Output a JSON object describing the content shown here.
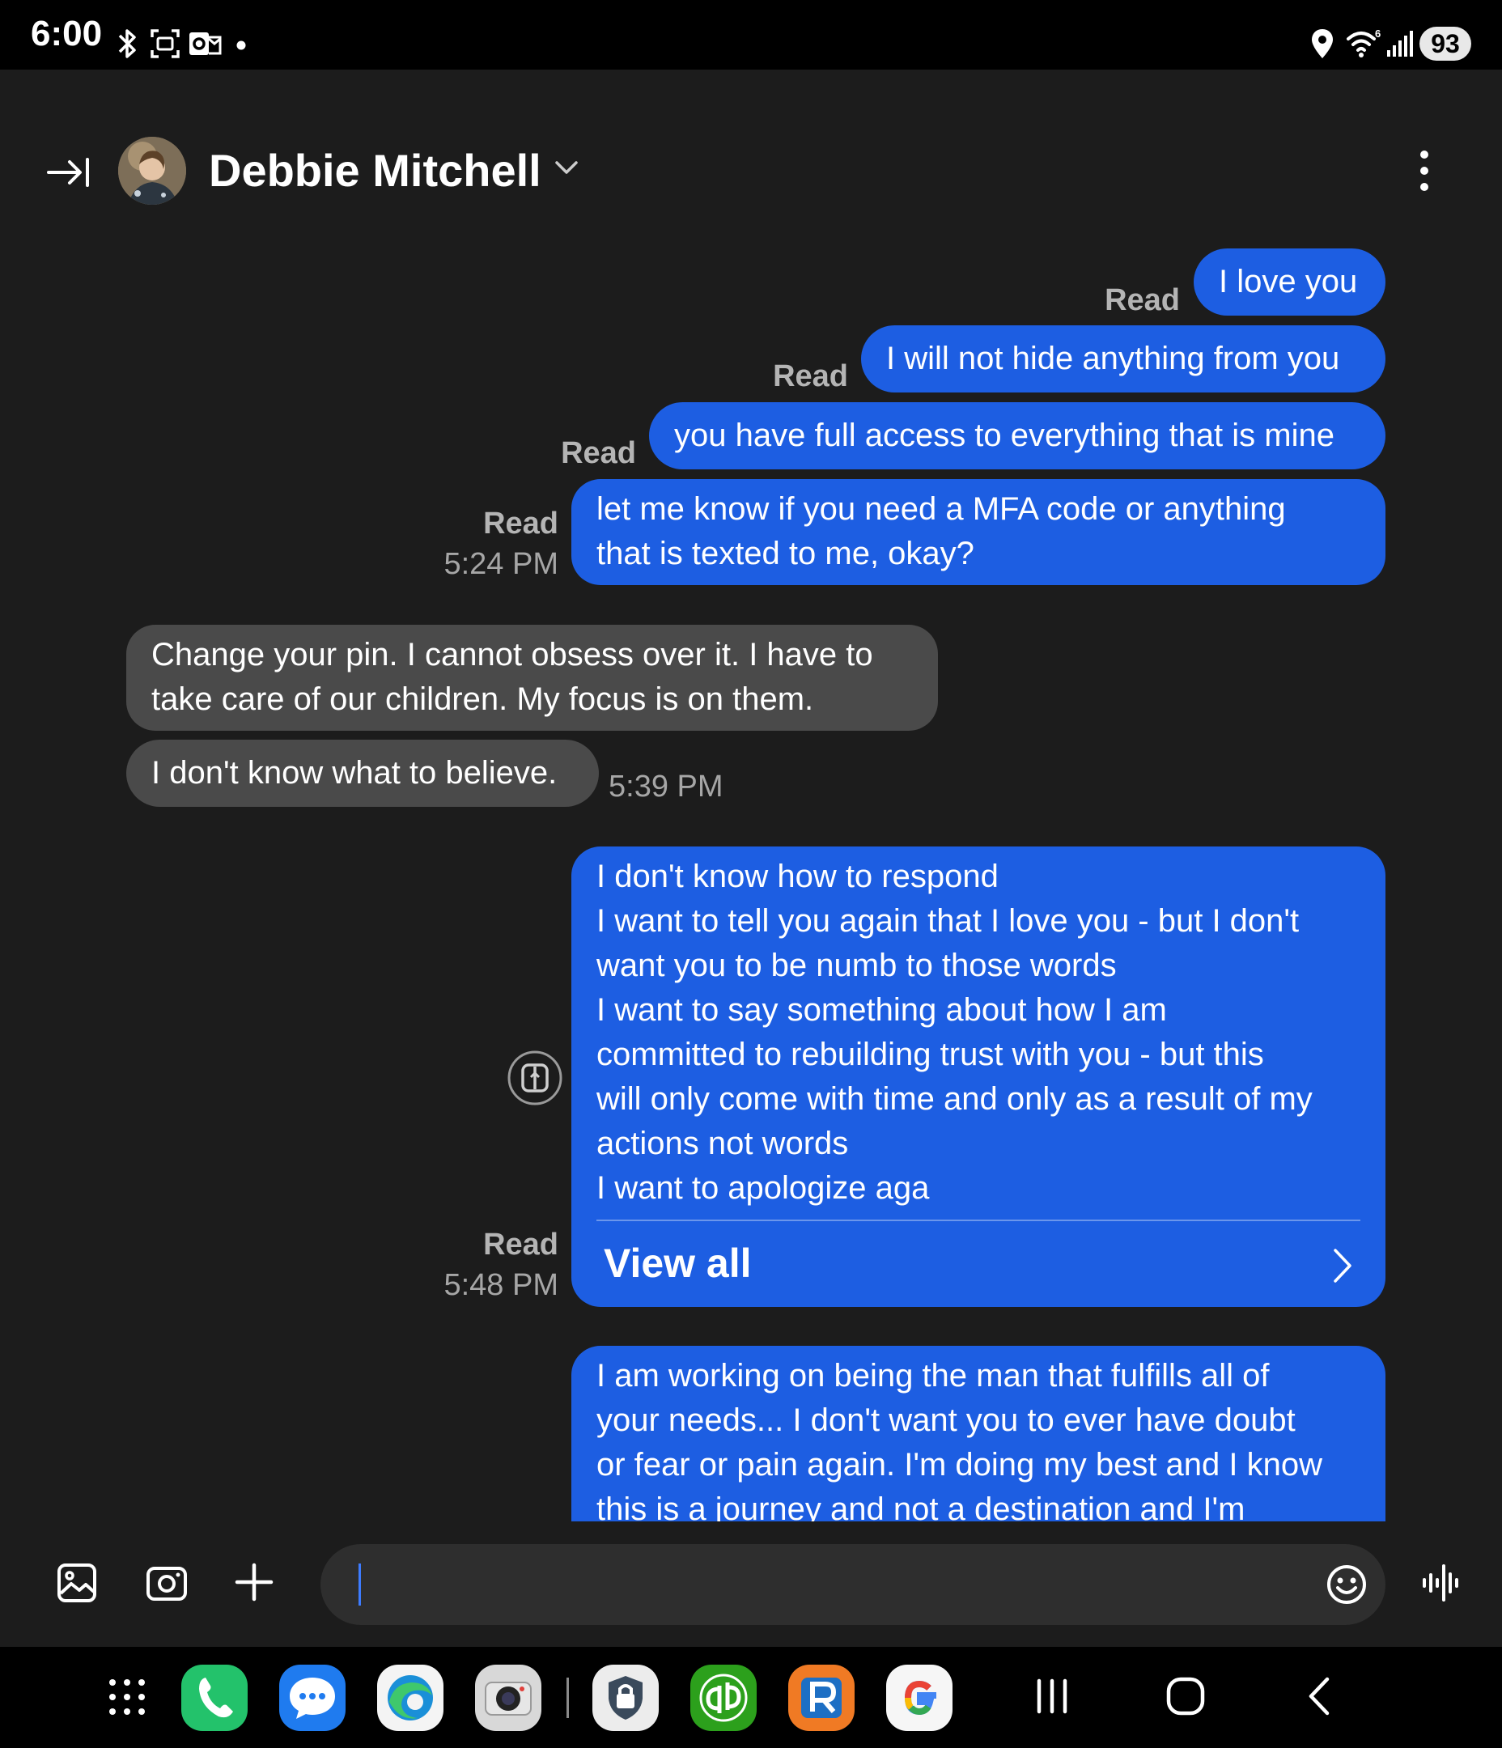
{
  "status_bar": {
    "time": "6:00",
    "battery": "93",
    "left_icons": [
      "bluetooth-icon",
      "screenshot-icon",
      "outlook-icon",
      "notification-dot-icon"
    ],
    "right_icons": [
      "location-icon",
      "wifi-6-icon",
      "signal-icon"
    ]
  },
  "header": {
    "contact_name": "Debbie Mitchell",
    "icons": [
      "collapse-panel-icon",
      "contact-avatar",
      "chevron-down-icon",
      "more-options-icon"
    ]
  },
  "messages": [
    {
      "direction": "sent",
      "text": "I love you",
      "status": "Read",
      "time": ""
    },
    {
      "direction": "sent",
      "text": "I will not hide anything from you",
      "status": "Read",
      "time": ""
    },
    {
      "direction": "sent",
      "text": "you have full access to everything that is mine",
      "status": "Read",
      "time": ""
    },
    {
      "direction": "sent",
      "text": "let me know if you need a MFA code or anything\nthat is texted to me, okay?",
      "status": "Read",
      "time": "5:24 PM"
    },
    {
      "direction": "received",
      "text": "Change your pin. I cannot obsess over it.  I have to\ntake care of our children.  My focus is on them.",
      "status": "",
      "time": ""
    },
    {
      "direction": "received",
      "text": "I don't know what to believe.",
      "status": "",
      "time": "5:39 PM"
    },
    {
      "direction": "sent",
      "text": "I don't know how to respond\nI want to tell you again that I love you - but I don't\nwant you to be numb to those words\nI want to say something about how I am\ncommitted to rebuilding trust with you - but this\nwill only come with time and only as a result of my\nactions not words\nI want to apologize aga",
      "status": "Read",
      "time": "5:48 PM",
      "view_all_label": "View all"
    },
    {
      "direction": "sent",
      "text": "I am working on being the man that fulfills all of\nyour needs... I don't want you to ever have doubt\nor fear or pain again. I'm doing my best and I know\nthis is a journey and not a destination and I'm",
      "status": "",
      "time": ""
    }
  ],
  "compose": {
    "input_value": "",
    "icons": [
      "gallery-icon",
      "camera-icon",
      "plus-icon",
      "emoji-icon",
      "voice-recorder-icon"
    ]
  },
  "nav_bar": {
    "apps": [
      "app-drawer-icon",
      "phone-app-icon",
      "messages-app-icon",
      "edge-browser-icon",
      "camera-app-icon",
      "security-app-icon",
      "quickbooks-app-icon",
      "r-app-icon",
      "google-app-icon"
    ],
    "buttons": [
      "recent-apps-button",
      "home-button",
      "back-button"
    ]
  },
  "colors": {
    "sent_bubble": "#1d5ee2",
    "received_bubble": "#4a4a4a",
    "background": "#1c1c1c",
    "caret": "#3d7cff"
  }
}
